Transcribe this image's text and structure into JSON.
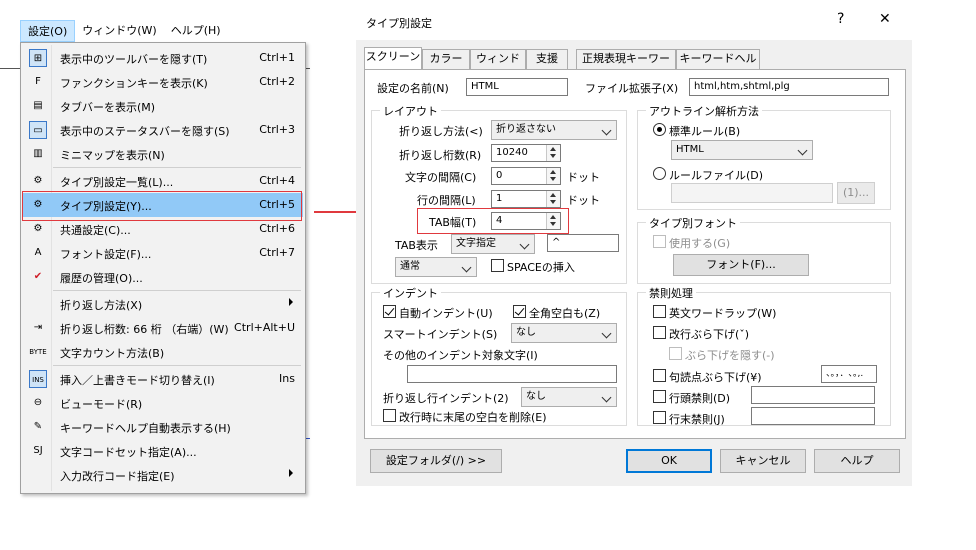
{
  "menubar": {
    "items": [
      "設定(O)",
      "ウィンドウ(W)",
      "ヘルプ(H)"
    ]
  },
  "menu": {
    "items": [
      {
        "icon": "toolbar-icon",
        "glyph": "⊞",
        "label": "表示中のツールバーを隠す(T)",
        "shortcut": "Ctrl+1",
        "boxed": true
      },
      {
        "icon": "function-keys-icon",
        "glyph": "F",
        "label": "ファンクションキーを表示(K)",
        "shortcut": "Ctrl+2"
      },
      {
        "icon": "tab-bar-icon",
        "glyph": "▤",
        "label": "タブバーを表示(M)",
        "shortcut": ""
      },
      {
        "icon": "statusbar-icon",
        "glyph": "▭",
        "label": "表示中のステータスバーを隠す(S)",
        "shortcut": "Ctrl+3",
        "boxed": true
      },
      {
        "icon": "minimap-icon",
        "glyph": "▥",
        "label": "ミニマップを表示(N)",
        "shortcut": ""
      },
      {
        "icon": "type-list-icon",
        "glyph": "⚙",
        "label": "タイプ別設定一覧(L)...",
        "shortcut": "Ctrl+4"
      },
      {
        "icon": "type-settings-icon",
        "glyph": "⚙",
        "label": "タイプ別設定(Y)...",
        "shortcut": "Ctrl+5"
      },
      {
        "icon": "common-settings-icon",
        "glyph": "⚙",
        "label": "共通設定(C)...",
        "shortcut": "Ctrl+6"
      },
      {
        "icon": "font-icon",
        "glyph": "A",
        "label": "フォント設定(F)...",
        "shortcut": "Ctrl+7"
      },
      {
        "icon": "history-check-icon",
        "glyph": "✔",
        "label": "履歴の管理(O)...",
        "shortcut": ""
      },
      {
        "icon": "",
        "glyph": "",
        "label": "折り返し方法(X)",
        "shortcut": "",
        "submenu": true
      },
      {
        "icon": "wrap-column-icon",
        "glyph": "⇥",
        "label": "折り返し桁数: 66 桁 （右端）(W)",
        "shortcut": "Ctrl+Alt+U"
      },
      {
        "icon": "byte-icon",
        "glyph": "BYTE",
        "label": "文字カウント方法(B)",
        "shortcut": ""
      },
      {
        "icon": "insert-mode-icon",
        "glyph": "INS",
        "label": "挿入／上書きモード切り替え(I)",
        "shortcut": "Ins",
        "boxed": true
      },
      {
        "icon": "view-mode-icon",
        "glyph": "⊖",
        "label": "ビューモード(R)",
        "shortcut": ""
      },
      {
        "icon": "keyword-help-icon",
        "glyph": "✎",
        "label": "キーワードヘルプ自動表示する(H)",
        "shortcut": ""
      },
      {
        "icon": "charset-icon",
        "glyph": "SJ",
        "label": "文字コードセット指定(A)...",
        "shortcut": ""
      },
      {
        "icon": "",
        "glyph": "",
        "label": "入力改行コード指定(E)",
        "shortcut": "",
        "submenu": true
      }
    ]
  },
  "dialog": {
    "title": "タイプ別設定",
    "help_glyph": "?",
    "close_glyph": "✕",
    "tabs": [
      "スクリーン",
      "カラー",
      "ウィンドウ",
      "支援",
      "正規表現キーワード",
      "キーワードヘルプ"
    ],
    "name_label": "設定の名前(N)",
    "name_value": "HTML",
    "ext_label": "ファイル拡張子(X)",
    "ext_value": "html,htm,shtml,plg",
    "layout": {
      "title": "レイアウト",
      "wrap_method_label": "折り返し方法(<)",
      "wrap_method_value": "折り返さない",
      "wrap_cols_label": "折り返し桁数(R)",
      "wrap_cols_value": "10240",
      "char_spacing_label": "文字の間隔(C)",
      "char_spacing_value": "0",
      "char_spacing_unit": "ドット",
      "line_spacing_label": "行の間隔(L)",
      "line_spacing_value": "1",
      "line_spacing_unit": "ドット",
      "tab_width_label": "TAB幅(T)",
      "tab_width_value": "4",
      "tab_display_label": "TAB表示",
      "tab_display_value": "文字指定",
      "tab_char_value": "^",
      "tab_arrow_value": "通常",
      "space_insert_label": "SPACEの挿入"
    },
    "outline": {
      "title": "アウトライン解析方法",
      "standard_label": "標準ルール(B)",
      "standard_value": "HTML",
      "rule_file_label": "ルールファイル(D)",
      "rule_file_value": "",
      "browse_label": "(1)..."
    },
    "type_font": {
      "title": "タイプ別フォント",
      "use_label": "使用する(G)",
      "font_button": "フォント(F)..."
    },
    "indent": {
      "title": "インデント",
      "auto_label": "自動インデント(U)",
      "fullwidth_label": "全角空白も(Z)",
      "smart_label": "スマートインデント(S)",
      "smart_value": "なし",
      "other_label": "その他のインデント対象文字(I)",
      "other_value": "",
      "wrap_indent_label": "折り返し行インデント(2)",
      "wrap_indent_value": "なし",
      "trim_label": "改行時に末尾の空白を削除(E)"
    },
    "kinsoku": {
      "title": "禁則処理",
      "word_wrap_label": "英文ワードラップ(W)",
      "newline_hang_label": "改行ぶら下げ(ˇ)",
      "hide_hang_label": "ぶら下げを隠す(-)",
      "punct_label": "句読点ぶら下げ(¥)",
      "punct_value": "、。，．､｡,.",
      "head_label": "行頭禁則(D)",
      "head_value": "",
      "tail_label": "行末禁則(J)",
      "tail_value": ""
    },
    "footer": {
      "folder_button": "設定フォルダ(/) >>",
      "ok_button": "OK",
      "cancel_button": "キャンセル",
      "help_button": "ヘルプ"
    }
  },
  "colors": {
    "highlight": "#91c9f7",
    "red_annotation": "#e0393e",
    "accent": "#0078d7"
  }
}
